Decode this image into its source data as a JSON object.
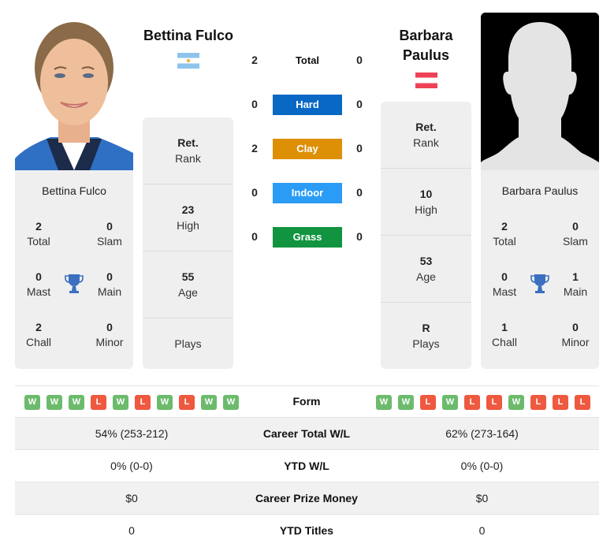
{
  "colors": {
    "hard": "#0868c4",
    "clay": "#dd8f06",
    "indoor": "#2b9cf6",
    "grass": "#119340",
    "win": "#6cbb6c",
    "loss": "#ee5940",
    "trophy": "#3b6fc0"
  },
  "player1": {
    "name": "Bettina Fulco",
    "country_flag": "argentina-flag",
    "photo": "player-photo",
    "card_name": "Bettina Fulco",
    "titles": {
      "total": {
        "value": "2",
        "label": "Total"
      },
      "slam": {
        "value": "0",
        "label": "Slam"
      },
      "mast": {
        "value": "0",
        "label": "Mast"
      },
      "main": {
        "value": "0",
        "label": "Main"
      },
      "chall": {
        "value": "2",
        "label": "Chall"
      },
      "minor": {
        "value": "0",
        "label": "Minor"
      }
    },
    "rank": {
      "value": "Ret.",
      "label": "Rank"
    },
    "high": {
      "value": "23",
      "label": "High"
    },
    "age": {
      "value": "55",
      "label": "Age"
    },
    "plays": {
      "value": "",
      "label": "Plays"
    },
    "form": [
      "W",
      "W",
      "W",
      "L",
      "W",
      "L",
      "W",
      "L",
      "W",
      "W"
    ]
  },
  "player2": {
    "name": "Barbara Paulus",
    "name_line1": "Barbara",
    "name_line2": "Paulus",
    "country_flag": "austria-flag",
    "photo": "silhouette-placeholder",
    "card_name": "Barbara Paulus",
    "titles": {
      "total": {
        "value": "2",
        "label": "Total"
      },
      "slam": {
        "value": "0",
        "label": "Slam"
      },
      "mast": {
        "value": "0",
        "label": "Mast"
      },
      "main": {
        "value": "1",
        "label": "Main"
      },
      "chall": {
        "value": "1",
        "label": "Chall"
      },
      "minor": {
        "value": "0",
        "label": "Minor"
      }
    },
    "rank": {
      "value": "Ret.",
      "label": "Rank"
    },
    "high": {
      "value": "10",
      "label": "High"
    },
    "age": {
      "value": "53",
      "label": "Age"
    },
    "plays": {
      "value": "R",
      "label": "Plays"
    },
    "form": [
      "W",
      "W",
      "L",
      "W",
      "L",
      "L",
      "W",
      "L",
      "L",
      "L"
    ]
  },
  "h2h": {
    "total": {
      "label": "Total",
      "p1": "2",
      "p2": "0"
    },
    "surfaces": [
      {
        "key": "hard",
        "label": "Hard",
        "p1": "0",
        "p2": "0"
      },
      {
        "key": "clay",
        "label": "Clay",
        "p1": "2",
        "p2": "0"
      },
      {
        "key": "indoor",
        "label": "Indoor",
        "p1": "0",
        "p2": "0"
      },
      {
        "key": "grass",
        "label": "Grass",
        "p1": "0",
        "p2": "0"
      }
    ]
  },
  "form_label": "Form",
  "table": [
    {
      "label": "Career Total W/L",
      "p1": "54% (253-212)",
      "p2": "62% (273-164)"
    },
    {
      "label": "YTD W/L",
      "p1": "0% (0-0)",
      "p2": "0% (0-0)"
    },
    {
      "label": "Career Prize Money",
      "p1": "$0",
      "p2": "$0"
    },
    {
      "label": "YTD Titles",
      "p1": "0",
      "p2": "0"
    }
  ]
}
